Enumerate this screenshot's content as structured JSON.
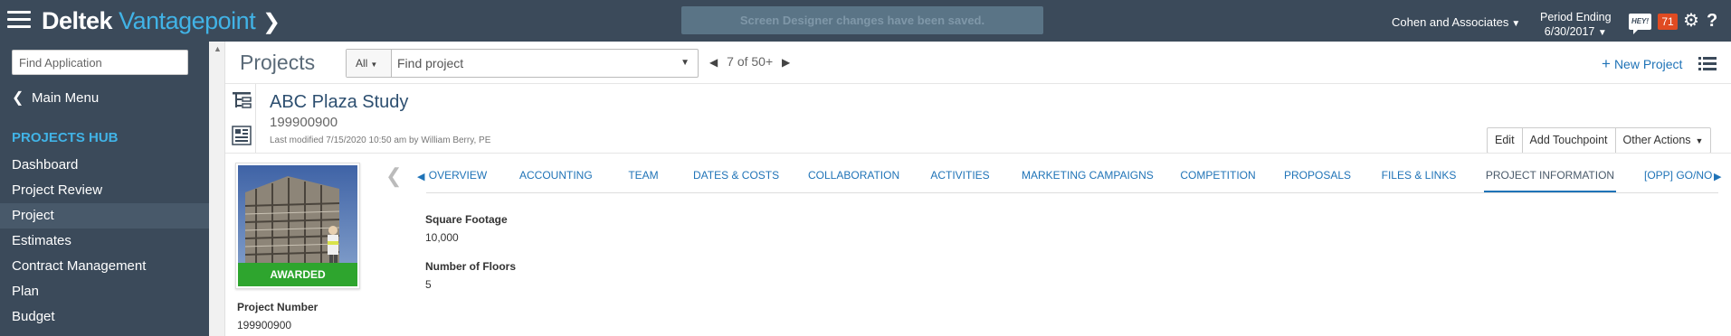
{
  "topbar": {
    "brand_left": "Deltek",
    "brand_right": "Vantagepoint",
    "toast": "Screen Designer changes have been saved.",
    "company": "Cohen and Associates",
    "period_label": "Period Ending",
    "period_date": "6/30/2017",
    "hey_label": "HEY!",
    "notification_count": "71"
  },
  "sidebar": {
    "search_placeholder": "Find Application",
    "main_menu": "Main Menu",
    "hub_title": "PROJECTS HUB",
    "items": [
      {
        "label": "Dashboard"
      },
      {
        "label": "Project Review"
      },
      {
        "label": "Project"
      },
      {
        "label": "Estimates"
      },
      {
        "label": "Contract Management"
      },
      {
        "label": "Plan"
      },
      {
        "label": "Budget"
      }
    ]
  },
  "header": {
    "title": "Projects",
    "filter": "All",
    "search_placeholder": "Find project",
    "pager_current": "7",
    "pager_of": "of",
    "pager_total": "50+",
    "new_project": "New Project"
  },
  "record": {
    "name": "ABC Plaza Study",
    "number": "199900900",
    "modified": "Last modified 7/15/2020 10:50 am by William Berry, PE",
    "actions": {
      "edit": "Edit",
      "touchpoint": "Add Touchpoint",
      "other": "Other Actions"
    },
    "status": "AWARDED",
    "project_number_label": "Project Number",
    "project_number_value": "199900900"
  },
  "tabs": [
    {
      "label": "OVERVIEW"
    },
    {
      "label": "ACCOUNTING"
    },
    {
      "label": "TEAM"
    },
    {
      "label": "DATES & COSTS"
    },
    {
      "label": "COLLABORATION"
    },
    {
      "label": "ACTIVITIES"
    },
    {
      "label": "MARKETING CAMPAIGNS"
    },
    {
      "label": "COMPETITION"
    },
    {
      "label": "PROPOSALS"
    },
    {
      "label": "FILES & LINKS"
    },
    {
      "label": "PROJECT INFORMATION"
    },
    {
      "label": "[OPP] GO/NO"
    }
  ],
  "fields": [
    {
      "label": "Square Footage",
      "value": "10,000"
    },
    {
      "label": "Number of Floors",
      "value": "5"
    }
  ],
  "colors": {
    "navy": "#3b4a5a",
    "accent_blue": "#41b3e6",
    "link_blue": "#1f73b7",
    "awarded_green": "#2ea52e",
    "badge_orange": "#e04b22"
  }
}
